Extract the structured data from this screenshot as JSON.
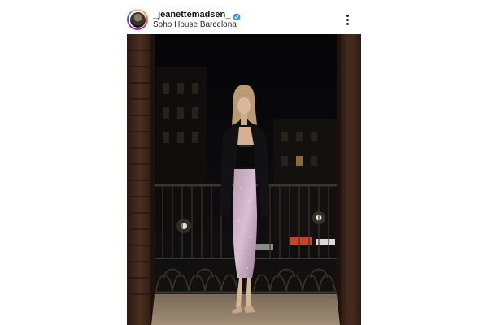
{
  "post": {
    "username": "_jeanettemadsen_",
    "location": "Soho House Barcelona",
    "verified": true,
    "verified_badge_color": "#3897f0"
  },
  "icons": {
    "avatar": "profile-avatar",
    "verified": "verified-badge-icon",
    "more": "more-options-icon"
  },
  "colors": {
    "background": "#ffffff",
    "text_primary": "#111111",
    "photo_dark": "#07070a"
  }
}
